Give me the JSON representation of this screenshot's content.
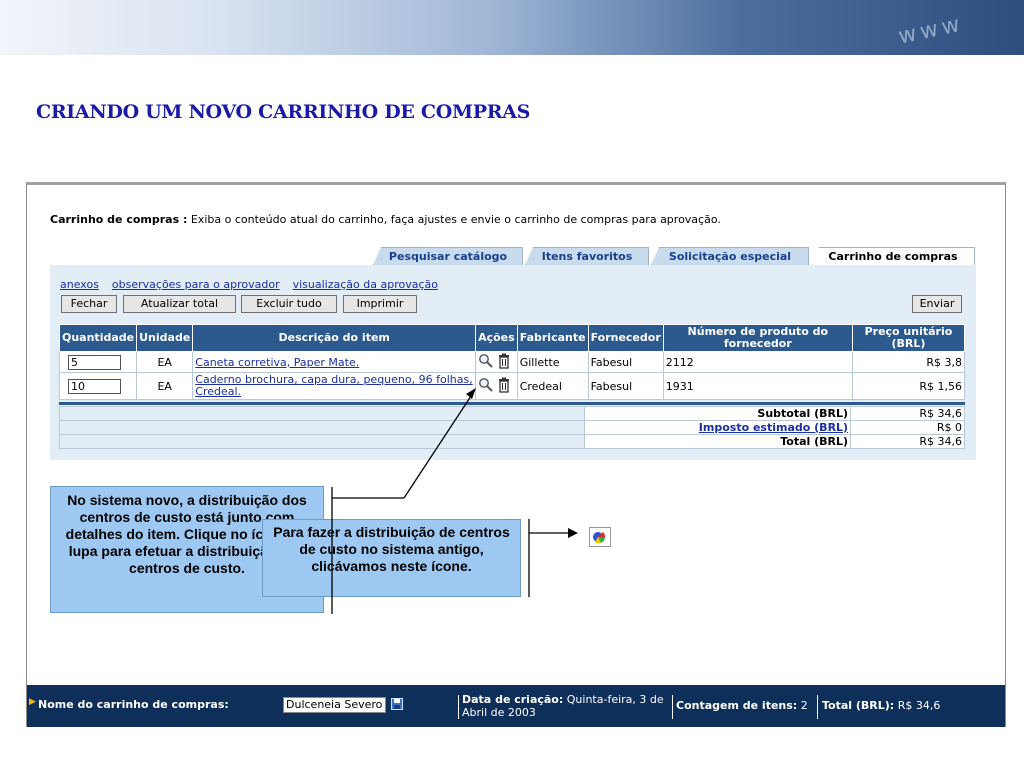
{
  "slide": {
    "title": "CRIANDO UM NOVO CARRINHO DE COMPRAS",
    "banner_text": "www"
  },
  "cart": {
    "heading_bold": "Carrinho de compras :",
    "heading_text": " Exiba o conteúdo atual do carrinho, faça ajustes e envie o carrinho de compras para aprovação."
  },
  "tabs": [
    {
      "label": "Pesquisar catálogo",
      "active": false
    },
    {
      "label": "Itens favoritos",
      "active": false
    },
    {
      "label": "Solicitação especial",
      "active": false
    },
    {
      "label": "Carrinho de compras",
      "active": true
    }
  ],
  "links": [
    "anexos",
    "observações para o aprovador",
    "visualização da aprovação"
  ],
  "buttons": {
    "close": "Fechar",
    "update_total": "Atualizar total",
    "delete_all": "Excluir tudo",
    "print": "Imprimir",
    "send": "Enviar"
  },
  "table": {
    "headers": [
      "Quantidade",
      "Unidade",
      "Descrição do item",
      "Ações",
      "Fabricante",
      "Fornecedor",
      "Número de produto do fornecedor",
      "Preço unitário (BRL)"
    ],
    "rows": [
      {
        "qty": "5",
        "unit": "EA",
        "desc": "Caneta corretiva, Paper Mate.",
        "maker": "Gillette",
        "supplier": "Fabesul",
        "part": "2112",
        "price": "R$ 3,8"
      },
      {
        "qty": "10",
        "unit": "EA",
        "desc": "Caderno brochura, capa dura, pequeno, 96 folhas, Credeal.",
        "maker": "Credeal",
        "supplier": "Fabesul",
        "part": "1931",
        "price": "R$ 1,56"
      }
    ]
  },
  "totals": {
    "subtotal_label": "Subtotal (BRL)",
    "subtotal": "R$ 34,6",
    "tax_label": "Imposto estimado (BRL)",
    "tax": "R$ 0",
    "total_label": "Total (BRL)",
    "total": "R$ 34,6"
  },
  "footer": {
    "name_label": "Nome do carrinho de compras:",
    "name_value": "Dulceneia Severo",
    "created_label": "Data de criação:",
    "created_value": " Quinta-feira, 3 de",
    "created_value2": "Abril de 2003",
    "count_label": "Contagem de itens:",
    "count_value": " 2",
    "total_label": "Total (BRL):",
    "total_value": " R$ 34,6"
  },
  "callouts": {
    "new_system": "No sistema novo, a distribuição dos centros de custo está junto com detalhes do item. Clique no ícone da lupa para efetuar a distribuição dos centros de custo.",
    "old_system": "Para fazer a distribuição de centros de custo no sistema antigo, clicávamos neste ícone."
  },
  "colors": {
    "header_blue": "#2c5a8e",
    "panel": "#e3edf5",
    "callout": "#9cc8f2",
    "footer": "#0e2f5a",
    "title": "#1a1aa8"
  }
}
